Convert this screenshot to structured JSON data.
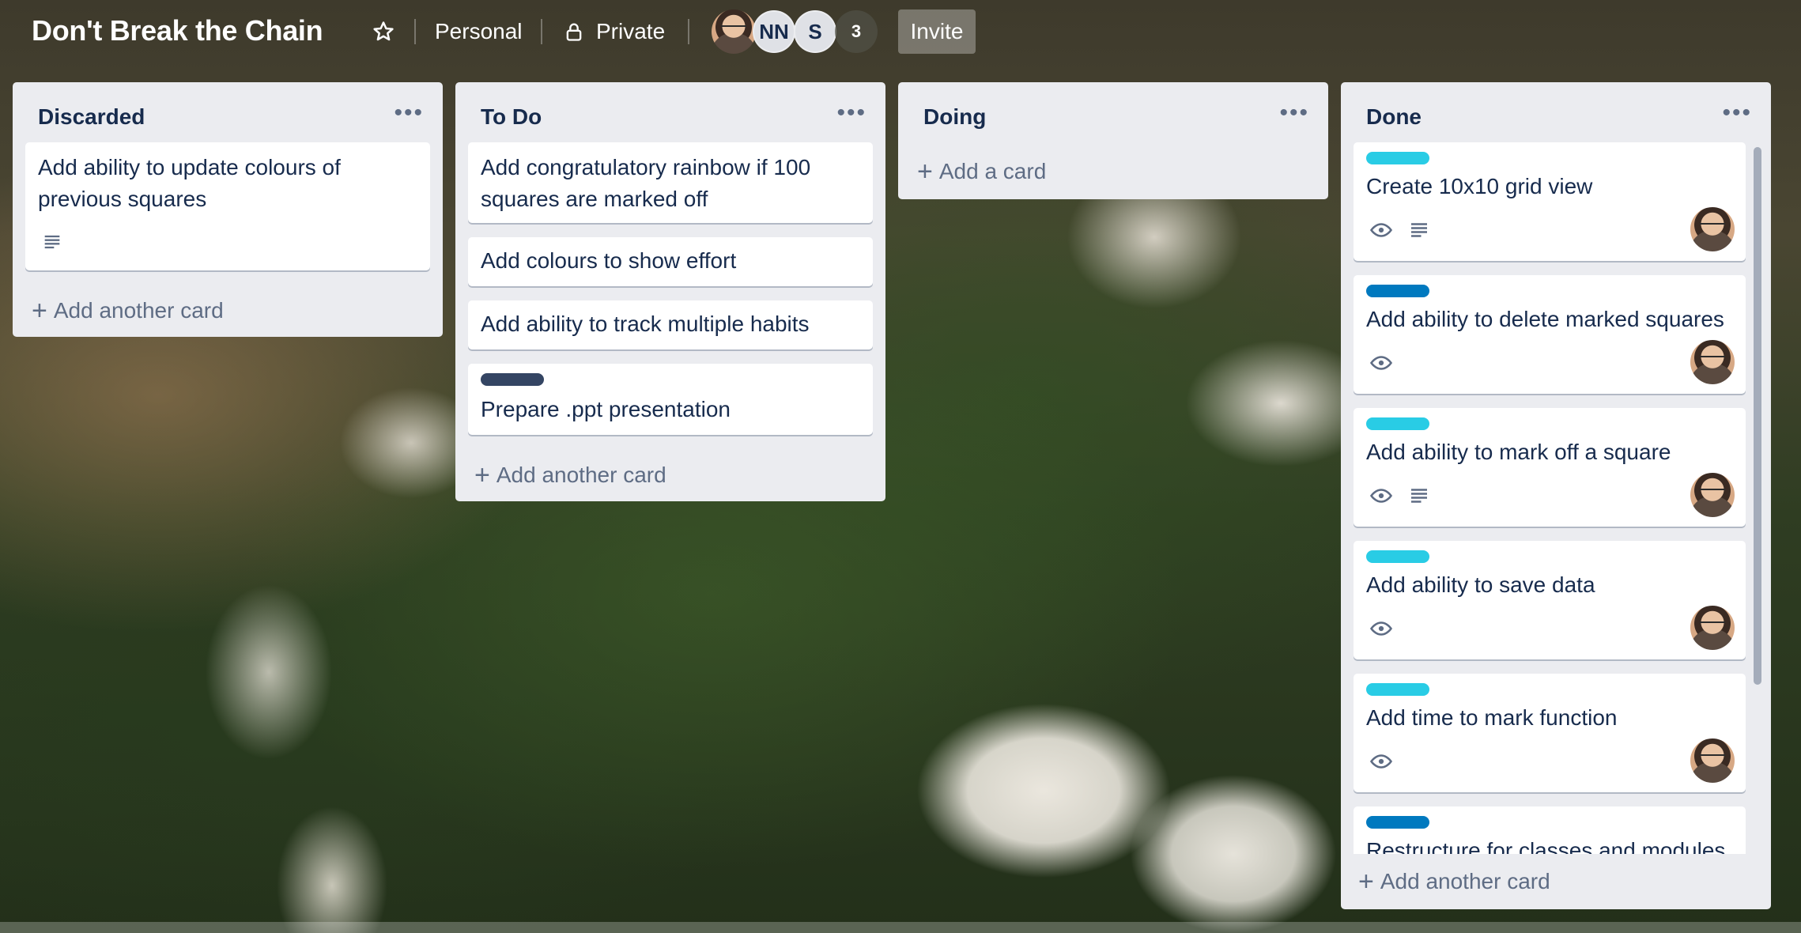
{
  "board": {
    "title": "Don't Break the Chain",
    "visibility_team": "Personal",
    "visibility_access": "Private",
    "members": [
      "NN",
      "S"
    ],
    "member_overflow": "3",
    "invite_label": "Invite"
  },
  "colors": {
    "list_bg": "#ebecf0",
    "label_cyan": "#29cce5",
    "label_blue": "#0079bf",
    "label_navy": "#344563",
    "text": "#172b4d",
    "muted": "#5e6c84"
  },
  "lists": [
    {
      "title": "Discarded",
      "cards": [
        {
          "title_line1": "Add ability to update colours of",
          "title_line2": "previous squares"
        }
      ],
      "add_label": "Add another card"
    },
    {
      "title": "To Do",
      "cards": [
        {
          "title_line1": "Add congratulatory rainbow if 100",
          "title_line2": "squares are marked off"
        },
        {
          "title": "Add colours to show effort"
        },
        {
          "title": "Add ability to track multiple habits"
        },
        {
          "title": "Prepare .ppt presentation"
        }
      ],
      "add_label": "Add another card"
    },
    {
      "title": "Doing",
      "cards": [],
      "add_label": "Add a card"
    },
    {
      "title": "Done",
      "cards": [
        {
          "title": "Create 10x10 grid view"
        },
        {
          "title": "Add ability to delete marked squares"
        },
        {
          "title": "Add ability to mark off a square"
        },
        {
          "title": "Add ability to save data"
        },
        {
          "title": "Add time to mark function"
        },
        {
          "title": "Restructure for classes and modules"
        }
      ],
      "add_label": "Add another card"
    }
  ]
}
